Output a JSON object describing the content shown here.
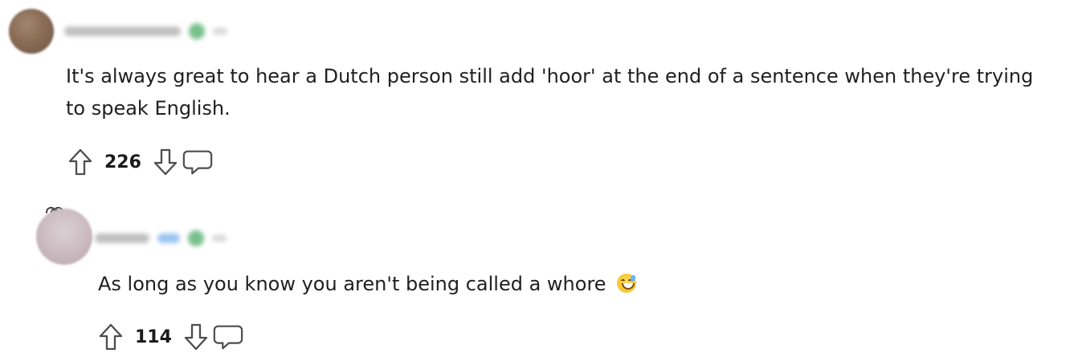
{
  "comments": [
    {
      "text": "It's always great to hear a Dutch person still add 'hoor' at the end of a sentence when they're trying to speak English.",
      "vote_count": "226",
      "icons": {
        "upvote": "arrow-up-outline-icon",
        "downvote": "arrow-down-outline-icon",
        "reply": "speech-bubble-icon"
      }
    },
    {
      "text": "As long as you know you aren't being called a whore",
      "vote_count": "114",
      "emoji": "grinning-face-with-sweat-icon",
      "icons": {
        "upvote": "arrow-up-outline-icon",
        "downvote": "arrow-down-outline-icon",
        "reply": "speech-bubble-icon"
      }
    }
  ],
  "thread_connector_icon": "thread-link-icon"
}
